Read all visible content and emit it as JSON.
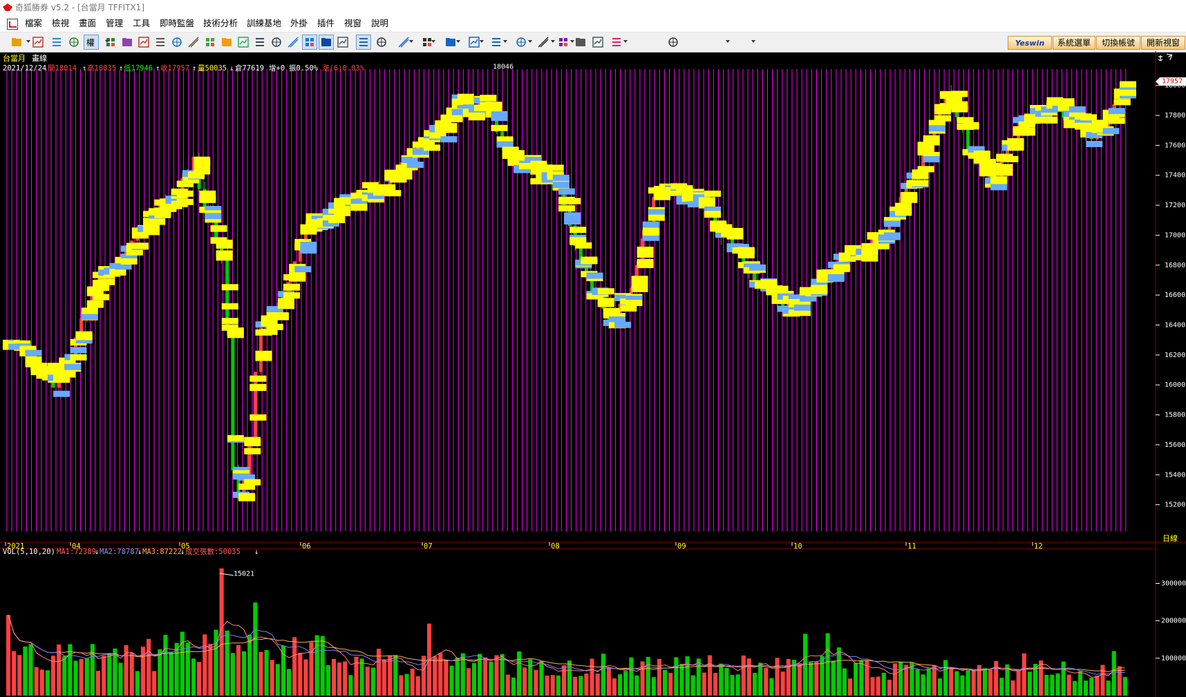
{
  "window": {
    "title": "奇狐勝券 v5.2 - [台當月 TFFITX1]"
  },
  "menu": [
    "檔案",
    "檢視",
    "畫面",
    "管理",
    "工具",
    "即時監盤",
    "技術分析",
    "訓練基地",
    "外掛",
    "插件",
    "視窗",
    "說明"
  ],
  "toolbar": {
    "icons": [
      "open-folder-icon",
      "stock-list-icon",
      "crosshair-icon",
      "layout-icon",
      "rights-icon",
      "chart-pick-icon",
      "chart-compare-icon",
      "list-icon",
      "copy-icon",
      "document-icon",
      "report-icon",
      "paint-icon",
      "alert-icon",
      "export-icon",
      "window-icon",
      "grid-icon",
      "chart-icon",
      "line-chart-icon",
      "kline-icon",
      "screen-icon",
      "draw-icon",
      "line-tool-icon",
      "fib-icon",
      "bars-tool-icon",
      "fan-icon",
      "channel-icon",
      "rect-tool-icon",
      "ellipse-tool-icon",
      "text-tool-icon",
      "layer-icon",
      "eraser-icon",
      "picture-icon",
      "palette-icon",
      "save-icon"
    ],
    "rights_label": "權",
    "buttons": {
      "yeswin": "Yeswin",
      "system_menu": "系統選單",
      "switch_account": "切換帳號",
      "new_window": "開新視窗"
    }
  },
  "header": {
    "instrument": "台當月",
    "chart_kind": "畫線",
    "date": "2021/12/24",
    "open": "開18014",
    "high": "高18035",
    "low": "低17946",
    "close": "收17957",
    "volume": "量50035",
    "open_interest": "倉77619",
    "oi_change": "增+0",
    "amplitude": "振0.50%",
    "change": "漲(6)0.03%",
    "arrows": {
      "up": "↑",
      "down": "↓"
    }
  },
  "price_panel": {
    "high_label": "18046",
    "low_label": "15021",
    "current_price": "17957",
    "ticks": [
      "18000",
      "17800",
      "17600",
      "17400",
      "17200",
      "17000",
      "16800",
      "16600",
      "16400",
      "16200",
      "16000",
      "15800",
      "15600",
      "15400",
      "15200"
    ]
  },
  "date_axis": {
    "labels": [
      "2021",
      "04",
      "05",
      "06",
      "07",
      "08",
      "09",
      "10",
      "11",
      "12"
    ],
    "unit": "日線"
  },
  "volume_panel": {
    "indicator": "VOL(5,10,20)",
    "ma1": "MA1:72389",
    "ma2": "MA2:78787",
    "ma3": "MA3:87222",
    "total": "成交張數:50035",
    "ticks": [
      "300000",
      "200000",
      "100000"
    ]
  },
  "colors": {
    "up": "#ff4040",
    "down": "#00cc00",
    "label": "#ffff00",
    "label_alt": "#4aa8ff",
    "grid": "#ff00ff",
    "ma1": "#ff8080",
    "ma2": "#8080ff",
    "ma3": "#ffb050"
  },
  "chart_data": {
    "type": "candlestick",
    "title": "台當月 畫線",
    "x_range": [
      "2021-03",
      "2021-12-24"
    ],
    "ylim": [
      15000,
      18100
    ],
    "price_path": [
      [
        0,
        16250
      ],
      [
        0.02,
        16150
      ],
      [
        0.04,
        16000
      ],
      [
        0.06,
        16300
      ],
      [
        0.08,
        16700
      ],
      [
        0.1,
        16800
      ],
      [
        0.12,
        17050
      ],
      [
        0.14,
        17200
      ],
      [
        0.16,
        17400
      ],
      [
        0.165,
        17550
      ],
      [
        0.175,
        17200
      ],
      [
        0.19,
        16900
      ],
      [
        0.195,
        16600
      ],
      [
        0.2,
        15500
      ],
      [
        0.205,
        15200
      ],
      [
        0.215,
        15550
      ],
      [
        0.225,
        16400
      ],
      [
        0.24,
        16500
      ],
      [
        0.27,
        17100
      ],
      [
        0.33,
        17300
      ],
      [
        0.36,
        17500
      ],
      [
        0.4,
        17850
      ],
      [
        0.43,
        17850
      ],
      [
        0.45,
        17500
      ],
      [
        0.49,
        17350
      ],
      [
        0.52,
        16700
      ],
      [
        0.54,
        16400
      ],
      [
        0.56,
        16700
      ],
      [
        0.58,
        17300
      ],
      [
        0.62,
        17250
      ],
      [
        0.64,
        17000
      ],
      [
        0.67,
        16700
      ],
      [
        0.7,
        16500
      ],
      [
        0.74,
        16800
      ],
      [
        0.78,
        17000
      ],
      [
        0.82,
        17550
      ],
      [
        0.84,
        17950
      ],
      [
        0.86,
        17600
      ],
      [
        0.88,
        17350
      ],
      [
        0.9,
        17700
      ],
      [
        0.94,
        17850
      ],
      [
        0.97,
        17650
      ],
      [
        1.0,
        17957
      ]
    ],
    "volume_ma_levels": {
      "ma1": 72389,
      "ma2": 78787,
      "ma3": 87222
    },
    "last_volume": 50035
  }
}
